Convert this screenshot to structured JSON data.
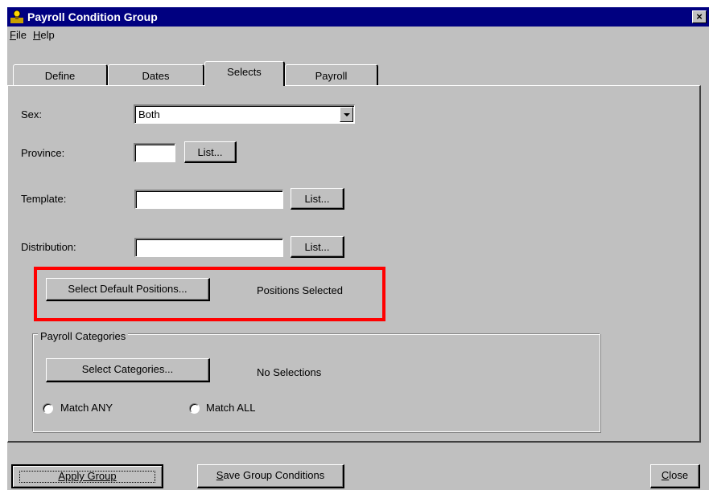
{
  "window": {
    "title": "Payroll Condition Group",
    "close_glyph": "×"
  },
  "menu": {
    "file_accel": "F",
    "file_rest": "ile",
    "help_accel": "H",
    "help_rest": "elp"
  },
  "tabs": [
    {
      "label": "Define",
      "active": false
    },
    {
      "label": "Dates",
      "active": false
    },
    {
      "label": "Selects",
      "active": true
    },
    {
      "label": "Payroll",
      "active": false
    }
  ],
  "form": {
    "sex_label": "Sex:",
    "sex_value": "Both",
    "province_label": "Province:",
    "province_value": "",
    "province_list_button": "List...",
    "template_label": "Template:",
    "template_value": "",
    "template_list_button": "List...",
    "distribution_label": "Distribution:",
    "distribution_value": "",
    "distribution_list_button": "List..."
  },
  "positions": {
    "button_label": "Select Default Positions...",
    "status_text": "Positions Selected",
    "highlight_color": "#ff0000"
  },
  "payroll_categories": {
    "group_title": "Payroll Categories",
    "button_label": "Select Categories...",
    "status_text": "No Selections",
    "radio_any_label": "Match ANY",
    "radio_all_label": "Match ALL"
  },
  "footer": {
    "apply_label": "Apply Group",
    "save_accel": "S",
    "save_rest": "ave Group Conditions",
    "close_accel": "C",
    "close_rest": "lose"
  },
  "colors": {
    "titlebar": "#000080",
    "face": "#c0c0c0"
  },
  "icons": {
    "app": "app-icon",
    "combo_arrow": "chevron-down-icon",
    "close": "close-icon"
  }
}
